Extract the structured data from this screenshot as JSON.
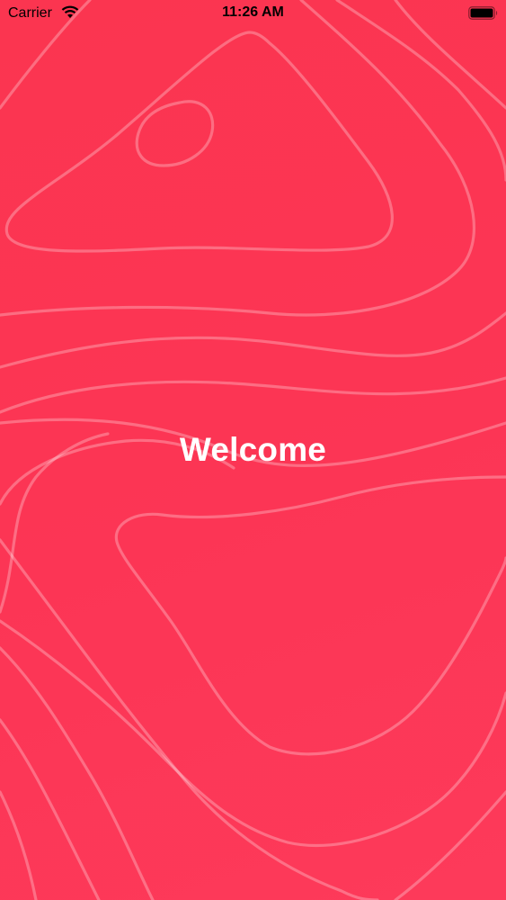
{
  "status_bar": {
    "carrier": "Carrier",
    "time": "11:26 AM",
    "wifi_icon": "wifi-icon",
    "battery_icon": "battery-icon"
  },
  "main": {
    "title": "Welcome"
  },
  "colors": {
    "background": "#fc3555",
    "contour_lines": "rgba(255,255,255,0.28)",
    "title_text": "#ffffff"
  }
}
